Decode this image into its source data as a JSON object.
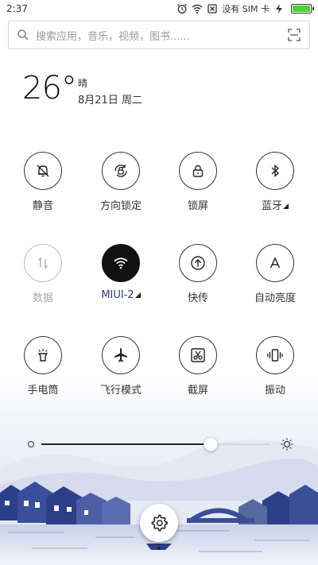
{
  "status_bar": {
    "time": "2:37",
    "sim_text": "没有 SIM 卡",
    "battery_level": 1.0,
    "icons": [
      "alarm-icon",
      "wifi-icon",
      "no-sim-icon",
      "charging-icon",
      "battery-icon"
    ]
  },
  "search": {
    "placeholder": "搜索应用，音乐，视频，图书......"
  },
  "weather": {
    "temperature": "26°",
    "condition": "晴",
    "date": "8月21日 周二"
  },
  "toggles": [
    {
      "label": "静音",
      "icon": "bell-off-icon",
      "state": "off"
    },
    {
      "label": "方向锁定",
      "icon": "rotation-lock-icon",
      "state": "off"
    },
    {
      "label": "锁屏",
      "icon": "lock-icon",
      "state": "off"
    },
    {
      "label": "蓝牙",
      "icon": "bluetooth-icon",
      "state": "off"
    },
    {
      "label": "数据",
      "icon": "mobile-data-icon",
      "state": "disabled"
    },
    {
      "label": "MIUI-2",
      "icon": "wifi-icon",
      "state": "on"
    },
    {
      "label": "快传",
      "icon": "quick-transfer-icon",
      "state": "off"
    },
    {
      "label": "自动亮度",
      "icon": "auto-brightness-icon",
      "state": "off"
    },
    {
      "label": "手电筒",
      "icon": "flashlight-icon",
      "state": "off"
    },
    {
      "label": "飞行模式",
      "icon": "airplane-icon",
      "state": "off"
    },
    {
      "label": "截屏",
      "icon": "screenshot-icon",
      "state": "off"
    },
    {
      "label": "振动",
      "icon": "vibrate-icon",
      "state": "off"
    }
  ],
  "brightness": {
    "level": 0.74
  },
  "colors": {
    "active_toggle": "#111111",
    "active_label": "#2b3a8f",
    "battery": "#4cd137",
    "scenery_blue": "#2c3f8a"
  }
}
